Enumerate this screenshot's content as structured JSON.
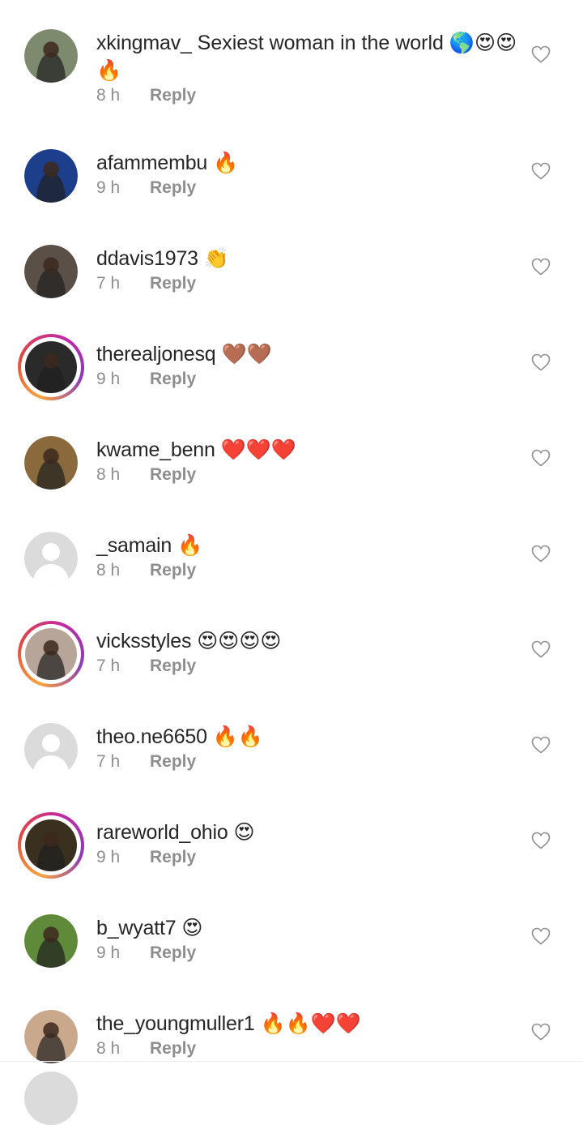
{
  "comments": [
    {
      "username": "xkingmav_",
      "text": "Sexiest woman in the world 🌎😍😍🔥",
      "time": "8 h",
      "reply": "Reply",
      "story_ring": false,
      "avatar": "photo",
      "avatar_color": "#7d8a6e"
    },
    {
      "username": "afammembu",
      "text": "🔥",
      "time": "9 h",
      "reply": "Reply",
      "story_ring": false,
      "avatar": "photo",
      "avatar_color": "#1d3e8a"
    },
    {
      "username": "ddavis1973",
      "text": "👏",
      "time": "7 h",
      "reply": "Reply",
      "story_ring": false,
      "avatar": "photo",
      "avatar_color": "#5a5048"
    },
    {
      "username": "therealjonesq",
      "text": "🤎🤎",
      "time": "9 h",
      "reply": "Reply",
      "story_ring": true,
      "avatar": "photo",
      "avatar_color": "#2a2a2a"
    },
    {
      "username": "kwame_benn",
      "text": "❤️❤️❤️",
      "time": "8 h",
      "reply": "Reply",
      "story_ring": false,
      "avatar": "photo",
      "avatar_color": "#8a6a3c"
    },
    {
      "username": "_samain",
      "text": "🔥",
      "time": "8 h",
      "reply": "Reply",
      "story_ring": false,
      "avatar": "default",
      "avatar_color": "#dbdbdb"
    },
    {
      "username": "vicksstyles",
      "text": "😍😍😍😍",
      "time": "7 h",
      "reply": "Reply",
      "story_ring": true,
      "avatar": "photo",
      "avatar_color": "#b8a59a"
    },
    {
      "username": "theo.ne6650",
      "text": "🔥🔥",
      "time": "7 h",
      "reply": "Reply",
      "story_ring": false,
      "avatar": "default",
      "avatar_color": "#dbdbdb"
    },
    {
      "username": "rareworld_ohio",
      "text": "😍",
      "time": "9 h",
      "reply": "Reply",
      "story_ring": true,
      "avatar": "photo",
      "avatar_color": "#3a3020"
    },
    {
      "username": "b_wyatt7",
      "text": "😍",
      "time": "9 h",
      "reply": "Reply",
      "story_ring": false,
      "avatar": "photo",
      "avatar_color": "#5f8a3a"
    },
    {
      "username": "the_youngmuller1",
      "text": "🔥🔥❤️❤️",
      "time": "8 h",
      "reply": "Reply",
      "story_ring": false,
      "avatar": "photo",
      "avatar_color": "#c9a88c"
    }
  ]
}
